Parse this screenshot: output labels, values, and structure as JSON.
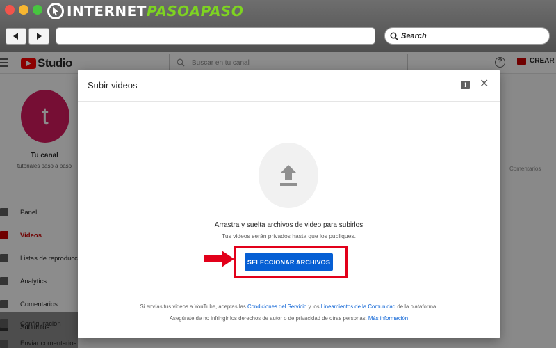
{
  "browser": {
    "logo_part_a": "INTERNET",
    "logo_part_b": "PASOAPASO",
    "search_placeholder": "Search"
  },
  "studio": {
    "logo_text": "Studio",
    "channel_search_placeholder": "Buscar en tu canal",
    "help_label": "?",
    "create_label": "CREAR"
  },
  "channel": {
    "avatar_letter": "t",
    "name": "Tu canal",
    "subtitle": "tutoriales paso a paso"
  },
  "sidebar": {
    "items": [
      {
        "label": "Panel",
        "icon": "dashboard-icon"
      },
      {
        "label": "Videos",
        "icon": "video-icon",
        "active": true
      },
      {
        "label": "Listas de reproducción",
        "icon": "playlist-icon"
      },
      {
        "label": "Analytics",
        "icon": "analytics-icon"
      },
      {
        "label": "Comentarios",
        "icon": "comments-icon"
      },
      {
        "label": "Subtítulos",
        "icon": "subtitles-icon"
      },
      {
        "label": "Configuración",
        "icon": "gear-icon"
      },
      {
        "label": "Enviar comentarios",
        "icon": "feedback-icon"
      }
    ]
  },
  "background": {
    "column_comentarios": "Comentarios"
  },
  "modal": {
    "title": "Subir videos",
    "feedback_icon_label": "!",
    "close_label": "✕",
    "drop_title": "Arrastra y suelta archivos de video para subirlos",
    "drop_subtitle": "Tus videos serán privados hasta que los publiques.",
    "select_button": "SELECCIONAR ARCHIVOS",
    "legal1_pre": "Si envías tus videos a YouTube, aceptas las ",
    "legal1_link1": "Condiciones del Servicio",
    "legal1_mid": " y los ",
    "legal1_link2": "Lineamientos de la Comunidad",
    "legal1_post": " de la plataforma.",
    "legal2_pre": "Asegúrate de no infringir los derechos de autor o de privacidad de otras personas. ",
    "legal2_link": "Más información"
  },
  "colors": {
    "accent_blue": "#065fd4",
    "highlight_red": "#e2001a",
    "yt_red": "#ff0000",
    "avatar_pink": "#d81b60",
    "logo_green": "#7ed321"
  }
}
